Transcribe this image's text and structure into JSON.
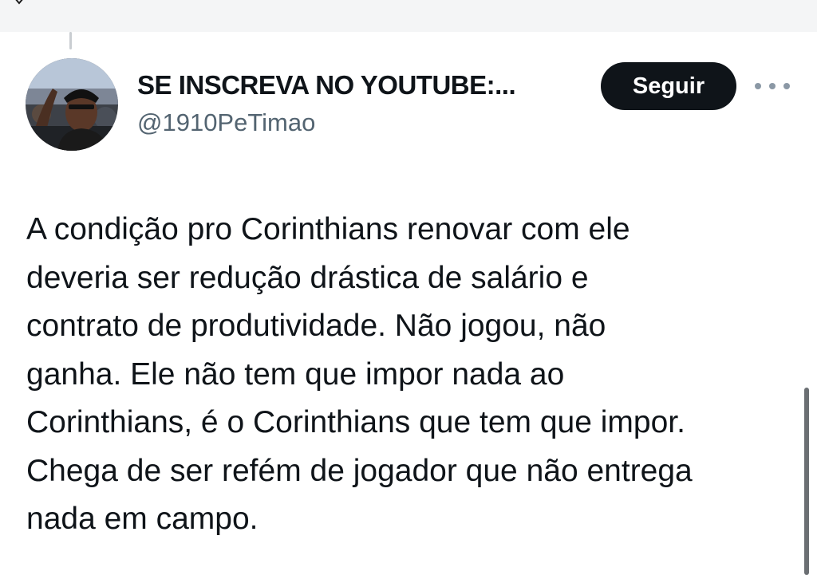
{
  "author": {
    "display_name": "SE INSCREVA NO YOUTUBE:...",
    "handle": "@1910PeTimao",
    "avatar_icon": "profile-photo"
  },
  "actions": {
    "follow_label": "Seguir",
    "more_icon": "more-horizontal-icon"
  },
  "tweet": {
    "text": "A condição pro Corinthians renovar com ele\ndeveria ser redução drástica de salário e\ncontrato de produtividade. Não jogou, não\nganha. Ele não tem que impor nada ao\nCorinthians, é o Corinthians que tem que impor.\nChega de ser refém de jogador que não entrega\nnada em campo."
  },
  "colors": {
    "primary_text": "#0f1419",
    "secondary_text": "#536471",
    "follow_button_bg": "#0f1419",
    "follow_button_text": "#ffffff"
  }
}
